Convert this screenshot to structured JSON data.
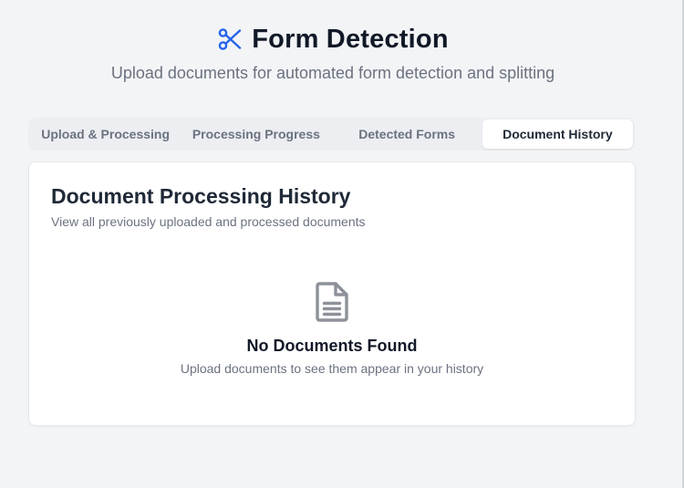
{
  "header": {
    "icon": "scissors-icon",
    "title": "Form Detection",
    "subtitle": "Upload documents for automated form detection and splitting",
    "accent_color": "#2563eb"
  },
  "tabs": [
    {
      "label": "Upload & Processing",
      "active": false
    },
    {
      "label": "Processing Progress",
      "active": false
    },
    {
      "label": "Detected Forms",
      "active": false
    },
    {
      "label": "Document History",
      "active": true
    }
  ],
  "history": {
    "title": "Document Processing History",
    "description": "View all previously uploaded and processed documents",
    "empty_state": {
      "icon": "document-icon",
      "title": "No Documents Found",
      "description": "Upload documents to see them appear in your history"
    }
  }
}
